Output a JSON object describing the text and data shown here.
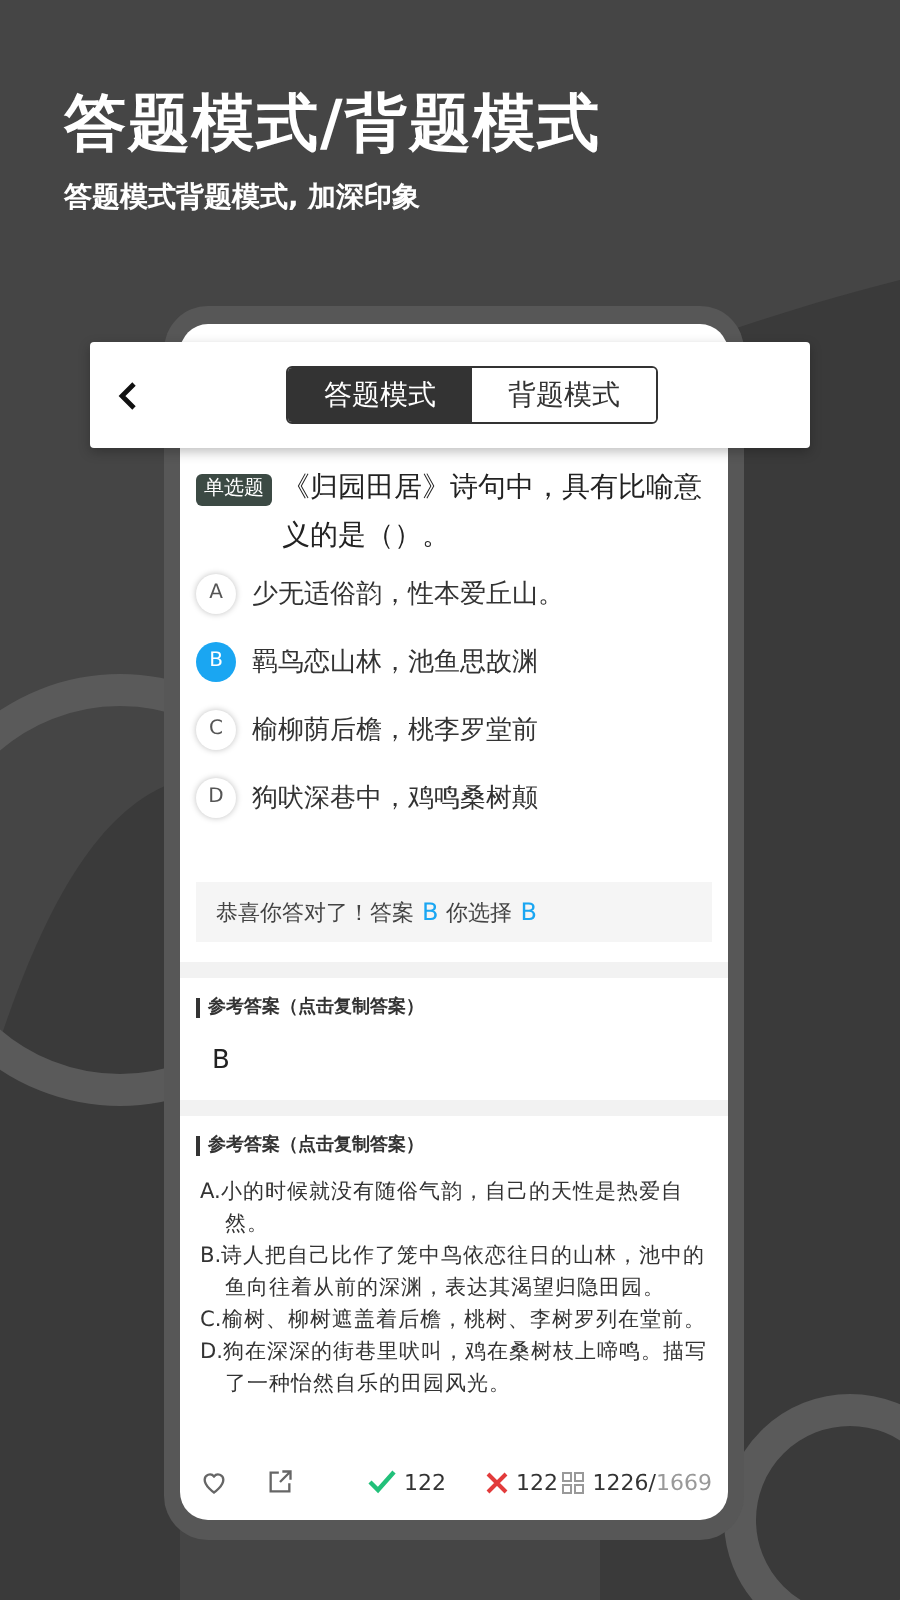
{
  "promo": {
    "title": "答题模式/背题模式",
    "subtitle": "答题模式背题模式, 加深印象"
  },
  "header": {
    "tabs": [
      {
        "label": "答题模式",
        "selected": true
      },
      {
        "label": "背题模式",
        "selected": false
      }
    ]
  },
  "question": {
    "tag": "单选题",
    "text": "《归园田居》诗句中，具有比喻意义的是（）。",
    "options": [
      {
        "letter": "A",
        "text": "少无适俗韵，性本爱丘山。",
        "selected": false
      },
      {
        "letter": "B",
        "text": "羁鸟恋山林，池鱼思故渊",
        "selected": true
      },
      {
        "letter": "C",
        "text": "榆柳荫后檐，桃李罗堂前",
        "selected": false
      },
      {
        "letter": "D",
        "text": "狗吠深巷中，鸡鸣桑树颠",
        "selected": false
      }
    ],
    "result": {
      "message": "恭喜你答对了！答案",
      "answer": "B",
      "chosen_label": "你选择",
      "chosen": "B"
    }
  },
  "sections": [
    {
      "heading": "参考答案（点击复制答案）",
      "kind": "answer",
      "body": [
        "B"
      ]
    },
    {
      "heading": "参考答案（点击复制答案）",
      "kind": "explanation",
      "body": [
        "A.小的时候就没有随俗气韵，自己的天性是热爱自然。",
        "B.诗人把自己比作了笼中鸟依恋往日的山林，池中的鱼向往着从前的深渊，表达其渴望归隐田园。",
        "C.榆树、柳树遮盖着后檐，桃树、李树罗列在堂前。",
        "D.狗在深深的街巷里吠叫，鸡在桑树枝上啼鸣。描写了一种怡然自乐的田园风光。"
      ]
    }
  ],
  "footer": {
    "correct": "122",
    "wrong": "122",
    "current": "1226",
    "separator": "/",
    "total": "1669"
  }
}
